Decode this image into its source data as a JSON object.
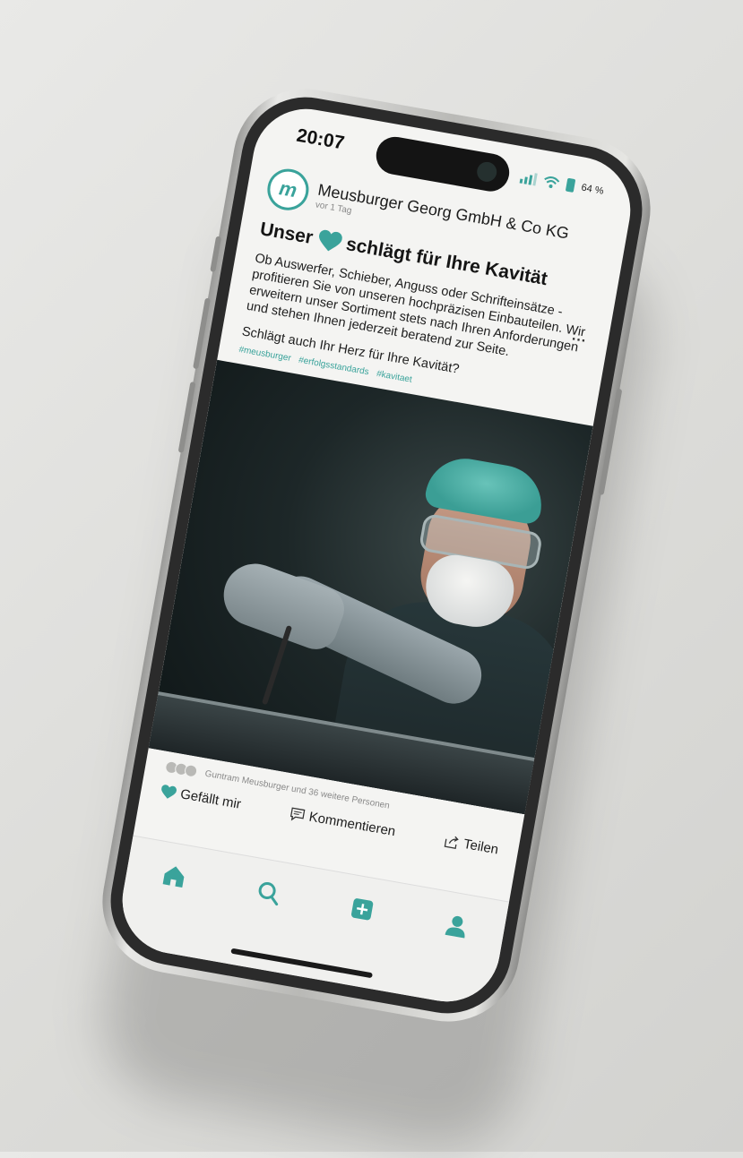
{
  "status_bar": {
    "time": "20:07",
    "battery": "64 %"
  },
  "post": {
    "author": "Meusburger Georg GmbH & Co KG",
    "avatar_letter": "m",
    "time": "vor 1 Tag",
    "more_label": "...",
    "headline_before": "Unser",
    "headline_after": "schlägt für Ihre Kavität",
    "body": "Ob Auswerfer, Schieber, Anguss oder Schrifteinsätze - profitieren Sie von unseren hochpräzisen Einbauteilen. Wir erweitern unser Sortiment stets nach Ihren Anforderungen und stehen Ihnen jederzeit beratend zur Seite.",
    "question": "Schlägt auch Ihr Herz für Ihre Kavität?",
    "hashtags": [
      "#meusburger",
      "#erfolgsstandards",
      "#kavitaet"
    ],
    "likes_text": "Guntram Meusburger und 36 weitere Personen",
    "actions": {
      "like": "Gefällt mir",
      "comment": "Kommentieren",
      "share": "Teilen"
    }
  },
  "tabs": [
    {
      "name": "home",
      "icon": "home-icon"
    },
    {
      "name": "search",
      "icon": "search-icon"
    },
    {
      "name": "add",
      "icon": "add-icon"
    },
    {
      "name": "profile",
      "icon": "profile-icon"
    }
  ],
  "colors": {
    "accent": "#3aa39b",
    "background": "#f4f4f2"
  }
}
